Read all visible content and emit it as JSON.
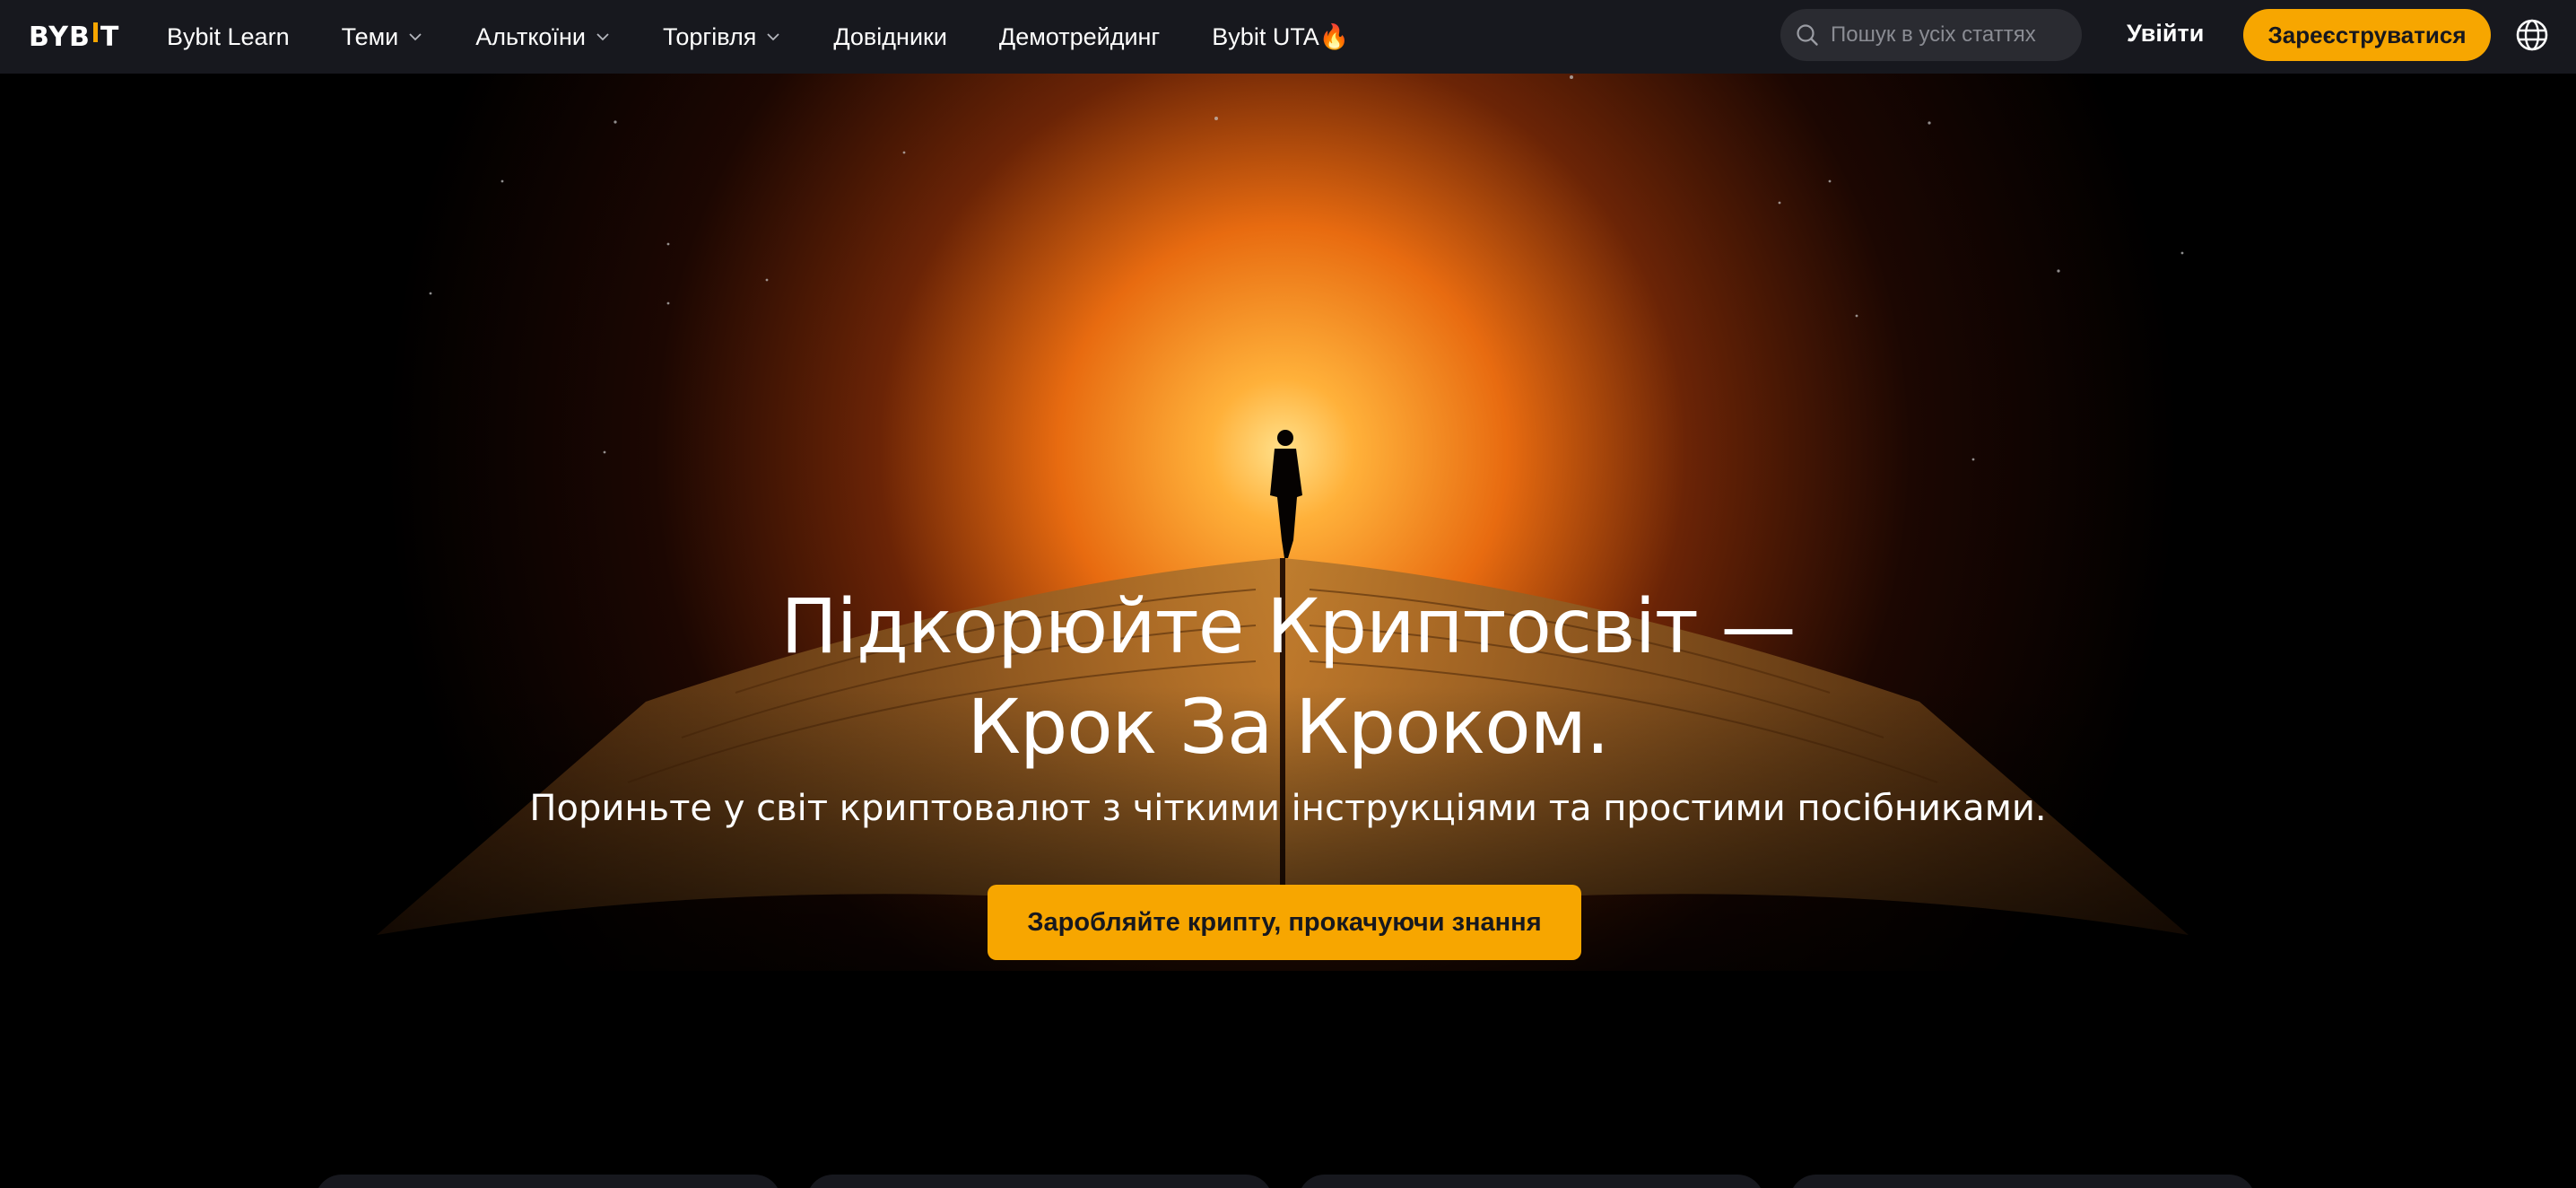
{
  "brand": {
    "logo_text": "BYBIT",
    "accent_color": "#f7a600",
    "nav_bg": "#17181e"
  },
  "nav": {
    "items": [
      {
        "label": "Bybit Learn",
        "dropdown": false
      },
      {
        "label": "Теми",
        "dropdown": true
      },
      {
        "label": "Альткоїни",
        "dropdown": true
      },
      {
        "label": "Торгівля",
        "dropdown": true
      },
      {
        "label": "Довідники",
        "dropdown": false
      },
      {
        "label": "Демотрейдинг",
        "dropdown": false
      },
      {
        "label": "Bybit UTA🔥",
        "dropdown": false
      }
    ],
    "search_placeholder": "Пошук в усіх статтях",
    "login_label": "Увійти",
    "signup_label": "Зареєструватися",
    "icons": {
      "search": "search-icon",
      "language": "globe-icon",
      "dropdown": "chevron-down-icon"
    }
  },
  "hero": {
    "title_line1": "Підкорюйте Криптосвіт —",
    "title_line2": "Крок За Кроком.",
    "subtitle": "Пориньте у світ криптовалют з чіткими інструкціями та простими посібниками.",
    "cta_label": "Заробляйте крипту, прокачуючи знання"
  }
}
